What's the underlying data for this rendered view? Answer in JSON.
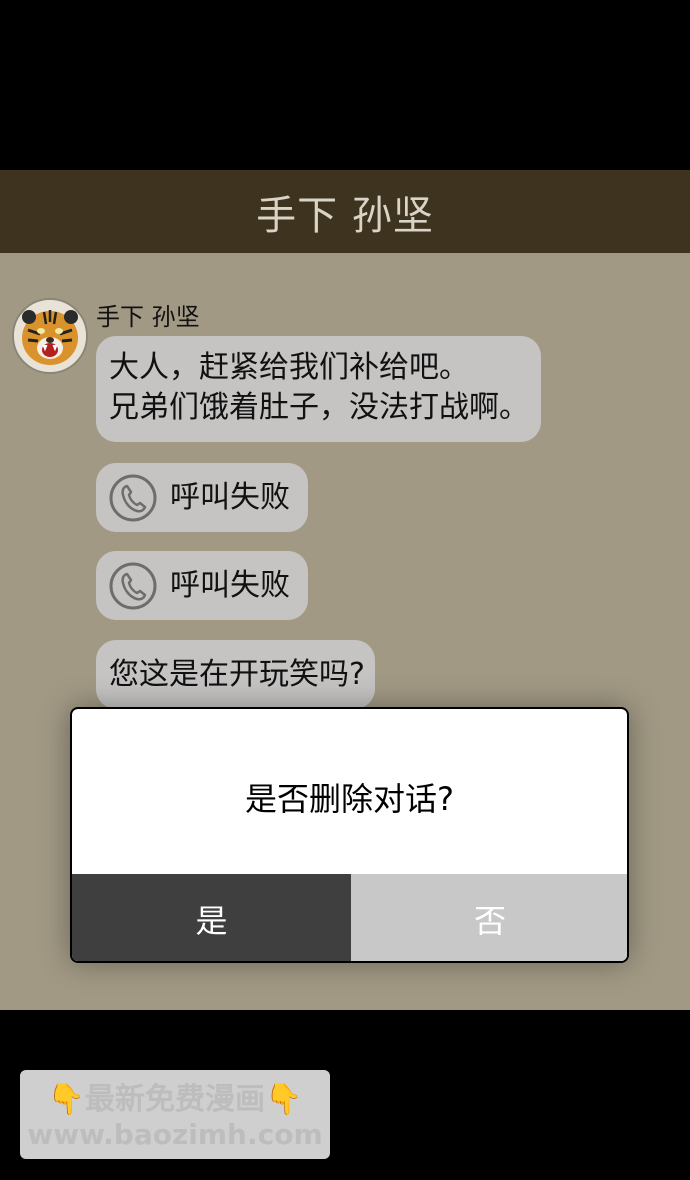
{
  "header": {
    "title": "手下 孙坚"
  },
  "chat": {
    "sender_name": "手下 孙坚",
    "avatar_icon": "tiger-avatar-icon",
    "messages": [
      {
        "type": "text",
        "text": "大人，赶紧给我们补给吧。\n兄弟们饿着肚子，没法打战啊。"
      },
      {
        "type": "call",
        "icon": "phone-icon",
        "text": "呼叫失败"
      },
      {
        "type": "call",
        "icon": "phone-icon",
        "text": "呼叫失败"
      },
      {
        "type": "text",
        "text": "您这是在开玩笑吗?"
      }
    ]
  },
  "dialog": {
    "message": "是否删除对话?",
    "confirm_label": "是",
    "cancel_label": "否"
  },
  "watermark": {
    "line1": "👇最新免费漫画👇",
    "line2": "www.baozimh.com"
  },
  "colors": {
    "header_bg": "#3d331f",
    "chat_bg": "#a19984",
    "bubble_bg": "#c5c4c3",
    "confirm_bg": "#3f3f3f",
    "cancel_bg": "#c8c8c8"
  }
}
